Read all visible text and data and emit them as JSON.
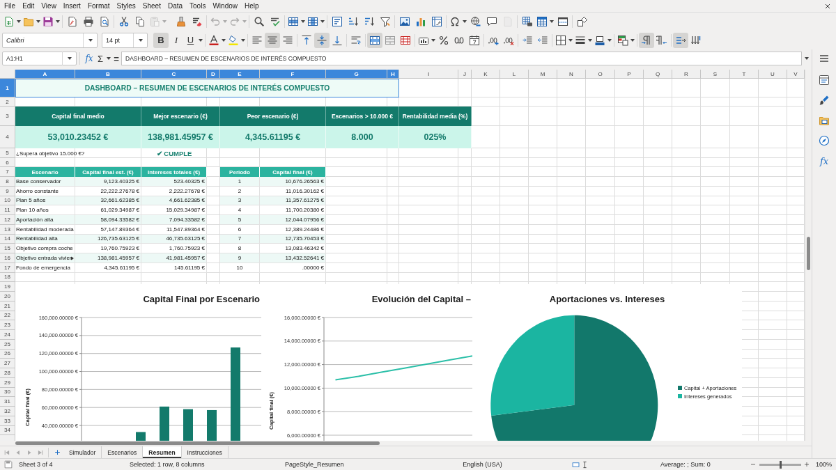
{
  "menu": [
    "File",
    "Edit",
    "View",
    "Insert",
    "Format",
    "Styles",
    "Sheet",
    "Data",
    "Tools",
    "Window",
    "Help"
  ],
  "standard_toolbar": [
    {
      "disabled": false
    },
    {
      "disabled": false
    },
    {
      "disabled": false
    },
    {
      "disabled": false
    },
    {
      "disabled": false
    },
    {
      "disabled": false
    },
    {
      "disabled": false
    },
    {
      "disabled": false
    },
    {
      "disabled": true
    },
    {
      "disabled": false
    },
    {
      "disabled": false
    },
    {
      "disabled": true
    },
    {
      "disabled": true
    },
    {
      "disabled": false
    },
    {
      "disabled": false
    },
    {
      "disabled": false
    },
    {
      "disabled": false
    },
    {
      "disabled": false
    },
    {
      "disabled": false
    },
    {
      "disabled": false
    },
    {
      "disabled": false
    },
    {
      "disabled": false
    },
    {
      "disabled": false
    },
    {
      "disabled": false
    },
    {
      "disabled": false
    },
    {
      "disabled": false
    },
    {
      "disabled": false
    },
    {
      "disabled": true
    },
    {
      "disabled": false
    },
    {
      "disabled": false
    },
    {
      "disabled": false
    },
    {
      "disabled": false
    }
  ],
  "formatting_toolbar": {
    "font_name": "Calibri",
    "font_size": "14 pt",
    "buttons": [
      {
        "label": "B",
        "on": true
      },
      {
        "label": "I",
        "on": false
      },
      {
        "label": "U",
        "on": false
      },
      {
        "on": false
      },
      {
        "on": false
      },
      {
        "on": false
      },
      {
        "on": true
      },
      {
        "on": false
      },
      {
        "on": false
      },
      {
        "on": true
      },
      {
        "on": false
      },
      {
        "on": false
      },
      {
        "on": true
      },
      {
        "on": false
      },
      {
        "on": false
      },
      {
        "on": false
      },
      {
        "on": false
      },
      {
        "on": false
      },
      {
        "on": false
      },
      {
        "on": false
      },
      {
        "on": false
      },
      {
        "on": false
      },
      {
        "on": false
      },
      {
        "on": false
      },
      {
        "on": false
      },
      {
        "on": false
      },
      {
        "on": false
      },
      {
        "on": true
      },
      {
        "on": false
      },
      {
        "on": true
      },
      {
        "on": false
      }
    ]
  },
  "formula_bar": {
    "name_box": "A1:H1",
    "function_wizard": "fx",
    "sum": "Σ",
    "equals": "=",
    "content": "DASHBOARD – RESUMEN DE ESCENARIOS DE INTERÉS COMPUESTO"
  },
  "sheet": {
    "column_headers": [
      {
        "label": "A",
        "selected": true
      },
      {
        "label": "B",
        "selected": true
      },
      {
        "label": "C",
        "selected": true
      },
      {
        "label": "D",
        "selected": true
      },
      {
        "label": "E",
        "selected": true
      },
      {
        "label": "F",
        "selected": true
      },
      {
        "label": "G",
        "selected": true
      },
      {
        "label": "H",
        "selected": true
      },
      {
        "label": "I",
        "selected": false
      },
      {
        "label": "J",
        "selected": false
      },
      {
        "label": "K",
        "selected": false
      },
      {
        "label": "L",
        "selected": false
      },
      {
        "label": "M",
        "selected": false
      },
      {
        "label": "N",
        "selected": false
      },
      {
        "label": "O",
        "selected": false
      },
      {
        "label": "P",
        "selected": false
      },
      {
        "label": "Q",
        "selected": false
      },
      {
        "label": "R",
        "selected": false
      },
      {
        "label": "S",
        "selected": false
      },
      {
        "label": "T",
        "selected": false
      },
      {
        "label": "U",
        "selected": false
      },
      {
        "label": "V",
        "selected": false
      }
    ],
    "row_headers": [
      {
        "label": "1",
        "selected": true
      },
      {
        "label": "2",
        "selected": false
      },
      {
        "label": "3",
        "selected": false
      },
      {
        "label": "4",
        "selected": false
      },
      {
        "label": "5",
        "selected": false
      },
      {
        "label": "6",
        "selected": false
      },
      {
        "label": "7",
        "selected": false
      },
      {
        "label": "8",
        "selected": false
      },
      {
        "label": "9",
        "selected": false
      },
      {
        "label": "10",
        "selected": false
      },
      {
        "label": "11",
        "selected": false
      },
      {
        "label": "12",
        "selected": false
      },
      {
        "label": "13",
        "selected": false
      },
      {
        "label": "14",
        "selected": false
      },
      {
        "label": "15",
        "selected": false
      },
      {
        "label": "16",
        "selected": false
      },
      {
        "label": "17",
        "selected": false
      },
      {
        "label": "18",
        "selected": false
      },
      {
        "label": "19",
        "selected": false
      },
      {
        "label": "20",
        "selected": false
      },
      {
        "label": "21",
        "selected": false
      },
      {
        "label": "22",
        "selected": false
      },
      {
        "label": "23",
        "selected": false
      },
      {
        "label": "24",
        "selected": false
      },
      {
        "label": "25",
        "selected": false
      },
      {
        "label": "26",
        "selected": false
      },
      {
        "label": "27",
        "selected": false
      },
      {
        "label": "28",
        "selected": false
      },
      {
        "label": "29",
        "selected": false
      },
      {
        "label": "30",
        "selected": false
      },
      {
        "label": "31",
        "selected": false
      },
      {
        "label": "32",
        "selected": false
      },
      {
        "label": "33",
        "selected": false
      },
      {
        "label": "34",
        "selected": false
      }
    ],
    "title": {
      "text": "DASHBOARD – RESUMEN DE ESCENARIOS DE INTERÉS COMPUESTO",
      "selected": true
    },
    "kpis": [
      {
        "label": "Capital final medio",
        "value": "53,010.23452 €"
      },
      {
        "label": "Mejor escenario (€)",
        "value": "138,981.45957 €"
      },
      {
        "label": "Peor escenario (€)",
        "value": "4,345.61195 €"
      },
      {
        "label": "Escenarios > 10.000 €",
        "value": "8.000"
      },
      {
        "label": "Rentabilidad media (%)",
        "value": "025%"
      }
    ],
    "target_check": {
      "label": "¿Supera objetivo 15.000 €?",
      "result": "✔ CUMPLE"
    },
    "scenarios": {
      "columns": [
        "Escenario",
        "Capital final est. (€)",
        "Intereses totales (€)"
      ],
      "rows": [
        {
          "cells": [
            "Base conservador",
            "9,123.40325 €",
            "523.40325 €"
          ],
          "overflow": false
        },
        {
          "cells": [
            "Ahorro constante",
            "22,222.27678 €",
            "2,222.27678 €"
          ],
          "overflow": false
        },
        {
          "cells": [
            "Plan 5 años",
            "32,661.62385 €",
            "4,661.62385 €"
          ],
          "overflow": false
        },
        {
          "cells": [
            "Plan 10 años",
            "61,029.34987 €",
            "15,029.34987 €"
          ],
          "overflow": false
        },
        {
          "cells": [
            "Aportación alta",
            "58,094.33582 €",
            "7,094.33582 €"
          ],
          "overflow": false
        },
        {
          "cells": [
            "Rentabilidad moderada",
            "57,147.89364 €",
            "11,547.89364 €"
          ],
          "overflow": false
        },
        {
          "cells": [
            "Rentabilidad alta",
            "126,735.63125 €",
            "46,735.63125 €"
          ],
          "overflow": false
        },
        {
          "cells": [
            "Objetivo compra coche",
            "19,760.75923 €",
            "1,760.75923 €"
          ],
          "overflow": false
        },
        {
          "cells": [
            "Objetivo entrada vivien",
            "138,981.45957 €",
            "41,981.45957 €"
          ],
          "overflow": true
        },
        {
          "cells": [
            "Fondo de emergencia",
            "4,345.61195 €",
            "145.61195 €"
          ],
          "overflow": false
        }
      ]
    },
    "periods": {
      "columns": [
        "Periodo",
        "Capital final (€)"
      ],
      "rows": [
        [
          "1",
          "10,676.26563 €"
        ],
        [
          "2",
          "11,016.30162 €"
        ],
        [
          "3",
          "11,357.61275 €"
        ],
        [
          "4",
          "11,700.20380 €"
        ],
        [
          "5",
          "12,044.07956 €"
        ],
        [
          "6",
          "12,389.24486 €"
        ],
        [
          "7",
          "12,735.70453 €"
        ],
        [
          "8",
          "13,083.46342 €"
        ],
        [
          "9",
          "13,432.52641 €"
        ],
        [
          "10",
          ".00000 €"
        ]
      ]
    }
  },
  "charts": [
    {
      "chart_data": {
        "type": "bar",
        "title": "Capital Final por Escenario",
        "ylabel": "Capital final (€)",
        "ylim": [
          23000,
          160000
        ],
        "grid": true,
        "yticks": [
          {
            "value": 40000,
            "label": "40,000.00000 €"
          },
          {
            "value": 60000,
            "label": "60,000.00000 €"
          },
          {
            "value": 80000,
            "label": "80,000.00000 €"
          },
          {
            "value": 100000,
            "label": "100,000.00000 €"
          },
          {
            "value": 120000,
            "label": "120,000.00000 €"
          },
          {
            "value": 140000,
            "label": "140,000.00000 €"
          },
          {
            "value": 160000,
            "label": "160,000.00000 €"
          }
        ],
        "series": [
          {
            "color": "#137a6b",
            "values": [
              null,
              null,
              32700,
              61000,
              58100,
              57100,
              126700
            ]
          }
        ]
      }
    },
    {
      "chart_data": {
        "type": "line",
        "title": "Evolución del Capital –",
        "ylabel": "Capital final (€)",
        "ylim": [
          6000,
          16000
        ],
        "grid": true,
        "yticks": [
          {
            "value": 6000,
            "label": "6,000.00000 €"
          },
          {
            "value": 8000,
            "label": "8,000.00000 €"
          },
          {
            "value": 10000,
            "label": "10,000.00000 €"
          },
          {
            "value": 12000,
            "label": "12,000.00000 €"
          },
          {
            "value": 14000,
            "label": "14,000.00000 €"
          },
          {
            "value": 16000,
            "label": "16,000.00000 €"
          }
        ],
        "series": [
          {
            "color": "#2bbfa8",
            "values": [
              10700,
              11000,
              11350,
              11700,
              12050,
              12400,
              12750
            ]
          }
        ]
      }
    }
  ],
  "pie_chart": {
    "title": "Aportaciones vs. Intereses",
    "legend": [
      {
        "label": "Capital + Aportaciones",
        "color": "#12786b"
      },
      {
        "label": "Intereses generados",
        "color": "#1bb5a1"
      }
    ]
  },
  "sheet_tabs": [
    {
      "label": "Simulador",
      "selected": false
    },
    {
      "label": "Escenarios",
      "selected": false
    },
    {
      "label": "Resumen",
      "selected": true
    },
    {
      "label": "Instrucciones",
      "selected": false
    }
  ],
  "sidebar": {
    "functions": "fx"
  },
  "status_bar": {
    "sheet": "Sheet 3 of 4",
    "selection": "Selected: 1 row, 8 columns",
    "page_style": "PageStyle_Resumen",
    "language": "English (USA)",
    "summary": "Average: ; Sum: 0",
    "zoom_slider": {
      "level": 0.5
    },
    "zoom": "100%"
  }
}
